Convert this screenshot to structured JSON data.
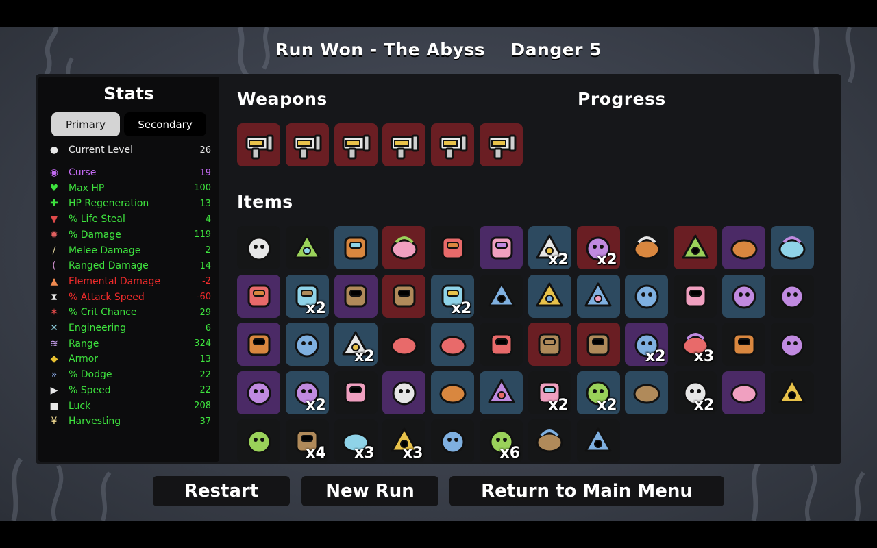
{
  "header": {
    "title": "Run Won - The Abyss",
    "danger": "Danger 5"
  },
  "stats": {
    "title": "Stats",
    "tabs": [
      {
        "label": "Primary",
        "selected": true
      },
      {
        "label": "Secondary",
        "selected": false
      }
    ],
    "current_level": {
      "label": "Current Level",
      "value": "26",
      "icon": "level-icon"
    },
    "rows": [
      {
        "label": "Curse",
        "value": "19",
        "color": "#c36af2",
        "icon": "curse-icon"
      },
      {
        "label": "Max HP",
        "value": "100",
        "color": "#3ee23e",
        "icon": "heart-icon"
      },
      {
        "label": "HP Regeneration",
        "value": "13",
        "color": "#3ee23e",
        "icon": "regen-icon"
      },
      {
        "label": "% Life Steal",
        "value": "4",
        "color": "#3ee23e",
        "icon": "life-steal-icon"
      },
      {
        "label": "% Damage",
        "value": "119",
        "color": "#3ee23e",
        "icon": "damage-icon"
      },
      {
        "label": "Melee Damage",
        "value": "2",
        "color": "#3ee23e",
        "icon": "sword-icon"
      },
      {
        "label": "Ranged Damage",
        "value": "14",
        "color": "#3ee23e",
        "icon": "bow-icon"
      },
      {
        "label": "Elemental Damage",
        "value": "-2",
        "color": "#ee2b2b",
        "icon": "flame-icon"
      },
      {
        "label": "% Attack Speed",
        "value": "-60",
        "color": "#ee2b2b",
        "icon": "hourglass-icon"
      },
      {
        "label": "% Crit Chance",
        "value": "29",
        "color": "#3ee23e",
        "icon": "crit-icon"
      },
      {
        "label": "Engineering",
        "value": "6",
        "color": "#3ee23e",
        "icon": "engineering-icon"
      },
      {
        "label": "Range",
        "value": "324",
        "color": "#3ee23e",
        "icon": "range-icon"
      },
      {
        "label": "Armor",
        "value": "13",
        "color": "#3ee23e",
        "icon": "shield-icon"
      },
      {
        "label": "% Dodge",
        "value": "22",
        "color": "#3ee23e",
        "icon": "dodge-icon"
      },
      {
        "label": "% Speed",
        "value": "22",
        "color": "#3ee23e",
        "icon": "speed-icon"
      },
      {
        "label": "Luck",
        "value": "208",
        "color": "#3ee23e",
        "icon": "dice-icon"
      },
      {
        "label": "Harvesting",
        "value": "37",
        "color": "#3ee23e",
        "icon": "wheat-icon"
      }
    ]
  },
  "weapons": {
    "title": "Weapons",
    "items": [
      {
        "icon": "blaster-icon",
        "tier": 4
      },
      {
        "icon": "blaster-icon",
        "tier": 4
      },
      {
        "icon": "blaster-icon",
        "tier": 4
      },
      {
        "icon": "blaster-icon",
        "tier": 4
      },
      {
        "icon": "blaster-icon",
        "tier": 4
      },
      {
        "icon": "blaster-icon",
        "tier": 4
      }
    ]
  },
  "progress": {
    "title": "Progress"
  },
  "items": {
    "title": "Items",
    "list": [
      {
        "icon": "eyepatch-cookie-icon",
        "tier": 1,
        "qty": ""
      },
      {
        "icon": "fish-icon",
        "tier": 1,
        "qty": ""
      },
      {
        "icon": "snail-icon",
        "tier": 2,
        "qty": ""
      },
      {
        "icon": "rockets-icon",
        "tier": 4,
        "qty": ""
      },
      {
        "icon": "helmet-icon",
        "tier": 1,
        "qty": ""
      },
      {
        "icon": "mortar-icon",
        "tier": 3,
        "qty": ""
      },
      {
        "icon": "scarf-blade-icon",
        "tier": 2,
        "qty": "x2"
      },
      {
        "icon": "panda-icon",
        "tier": 4,
        "qty": "x2"
      },
      {
        "icon": "ghost-icon",
        "tier": 1,
        "qty": ""
      },
      {
        "icon": "anvil-icon",
        "tier": 4,
        "qty": ""
      },
      {
        "icon": "alien-eye-icon",
        "tier": 3,
        "qty": ""
      },
      {
        "icon": "butterfly-icon",
        "tier": 2,
        "qty": ""
      },
      {
        "icon": "baby-bottle-icon",
        "tier": 3,
        "qty": ""
      },
      {
        "icon": "potion-green-icon",
        "tier": 2,
        "qty": "x2"
      },
      {
        "icon": "spring-icon",
        "tier": 3,
        "qty": ""
      },
      {
        "icon": "statue-head-icon",
        "tier": 4,
        "qty": ""
      },
      {
        "icon": "leather-glove-icon",
        "tier": 2,
        "qty": "x2"
      },
      {
        "icon": "gravestone-icon",
        "tier": 1,
        "qty": ""
      },
      {
        "icon": "turret-icon",
        "tier": 2,
        "qty": ""
      },
      {
        "icon": "armor-plate-icon",
        "tier": 2,
        "qty": ""
      },
      {
        "icon": "rabbit-icon",
        "tier": 2,
        "qty": ""
      },
      {
        "icon": "egg-icon",
        "tier": 1,
        "qty": ""
      },
      {
        "icon": "goggles-icon",
        "tier": 2,
        "qty": ""
      },
      {
        "icon": "tree-icon",
        "tier": 1,
        "qty": ""
      },
      {
        "icon": "spray-icon",
        "tier": 3,
        "qty": ""
      },
      {
        "icon": "treasure-map-icon",
        "tier": 2,
        "qty": ""
      },
      {
        "icon": "spyglass-icon",
        "tier": 2,
        "qty": "x2"
      },
      {
        "icon": "bones-pot-icon",
        "tier": 1,
        "qty": ""
      },
      {
        "icon": "flask-icon",
        "tier": 2,
        "qty": ""
      },
      {
        "icon": "duck-icon",
        "tier": 1,
        "qty": ""
      },
      {
        "icon": "scroll-icon",
        "tier": 4,
        "qty": ""
      },
      {
        "icon": "red-scarf-icon",
        "tier": 4,
        "qty": ""
      },
      {
        "icon": "cat-icon",
        "tier": 3,
        "qty": "x2"
      },
      {
        "icon": "syringe-icon",
        "tier": 1,
        "qty": "x3"
      },
      {
        "icon": "meat-skewer-icon",
        "tier": 1,
        "qty": ""
      },
      {
        "icon": "banknote-icon",
        "tier": 1,
        "qty": ""
      },
      {
        "icon": "zombie-icon",
        "tier": 3,
        "qty": ""
      },
      {
        "icon": "claw-tool-icon",
        "tier": 2,
        "qty": "x2"
      },
      {
        "icon": "swirl-creature-icon",
        "tier": 1,
        "qty": ""
      },
      {
        "icon": "tomato-icon",
        "tier": 3,
        "qty": ""
      },
      {
        "icon": "jar-icon",
        "tier": 2,
        "qty": ""
      },
      {
        "icon": "pumpkin-icon",
        "tier": 2,
        "qty": ""
      },
      {
        "icon": "cake-slice-icon",
        "tier": 1,
        "qty": "x2"
      },
      {
        "icon": "chains-icon",
        "tier": 2,
        "qty": "x2"
      },
      {
        "icon": "wasp-icon",
        "tier": 2,
        "qty": ""
      },
      {
        "icon": "bandage-icon",
        "tier": 1,
        "qty": "x2"
      },
      {
        "icon": "bandana-icon",
        "tier": 3,
        "qty": ""
      },
      {
        "icon": "tooth-icon",
        "tier": 1,
        "qty": ""
      },
      {
        "icon": "lizard-icon",
        "tier": 1,
        "qty": ""
      },
      {
        "icon": "propeller-hat-icon",
        "tier": 1,
        "qty": "x4"
      },
      {
        "icon": "claw-mark-icon",
        "tier": 1,
        "qty": "x3"
      },
      {
        "icon": "mushroom-icon",
        "tier": 1,
        "qty": "x3"
      },
      {
        "icon": "whistle-icon",
        "tier": 1,
        "qty": ""
      },
      {
        "icon": "snowball-icon",
        "tier": 1,
        "qty": "x6"
      },
      {
        "icon": "worm-icon",
        "tier": 1,
        "qty": ""
      },
      {
        "icon": "penguin-icon",
        "tier": 1,
        "qty": ""
      }
    ]
  },
  "buttons": {
    "restart": "Restart",
    "new_run": "New Run",
    "main_menu": "Return to Main Menu"
  }
}
